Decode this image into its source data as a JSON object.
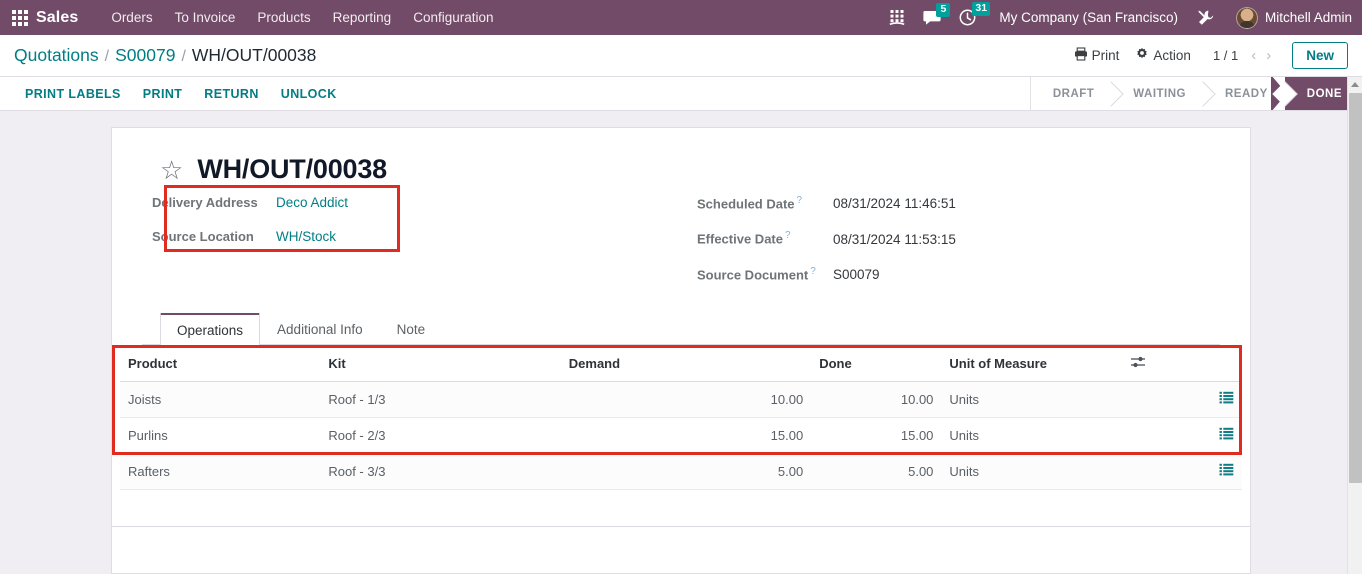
{
  "navbar": {
    "apps_icon": "apps-grid-icon",
    "brand": "Sales",
    "menus": [
      {
        "label": "Orders"
      },
      {
        "label": "To Invoice"
      },
      {
        "label": "Products"
      },
      {
        "label": "Reporting"
      },
      {
        "label": "Configuration"
      }
    ],
    "icons": {
      "dialpad": "dialpad-icon",
      "messages": "chat-icon",
      "messages_count": "5",
      "activities": "clock-icon",
      "activities_count": "31",
      "debug": "wrench-icon"
    },
    "company": "My Company (San Francisco)",
    "user": "Mitchell Admin",
    "accent_color": "#714B67",
    "badge_color": "#00A09D"
  },
  "control_panel": {
    "breadcrumb": [
      {
        "label": "Quotations",
        "current": false
      },
      {
        "label": "S00079",
        "current": false
      },
      {
        "label": "WH/OUT/00038",
        "current": true
      }
    ],
    "separator": "/",
    "print_label": "Print",
    "action_label": "Action",
    "pager": "1 / 1",
    "prev_arrow": "‹",
    "next_arrow": "›",
    "new_label": "New"
  },
  "statusbar": {
    "buttons": [
      {
        "label": "PRINT LABELS"
      },
      {
        "label": "PRINT"
      },
      {
        "label": "RETURN"
      },
      {
        "label": "UNLOCK"
      }
    ],
    "stages": [
      {
        "label": "DRAFT",
        "active": false
      },
      {
        "label": "WAITING",
        "active": false
      },
      {
        "label": "READY",
        "active": false
      },
      {
        "label": "DONE",
        "active": true
      }
    ]
  },
  "record": {
    "favorite_icon": "star-outline-icon",
    "title": "WH/OUT/00038",
    "fields_left": [
      {
        "label": "Delivery Address",
        "value": "Deco Addict",
        "link": true,
        "help": false
      },
      {
        "label": "Source Location",
        "value": "WH/Stock",
        "link": true,
        "help": false
      }
    ],
    "fields_right": [
      {
        "label": "Scheduled Date",
        "value": "08/31/2024 11:46:51",
        "link": false,
        "help": true
      },
      {
        "label": "Effective Date",
        "value": "08/31/2024 11:53:15",
        "link": false,
        "help": true
      },
      {
        "label": "Source Document",
        "value": "S00079",
        "link": false,
        "help": true
      }
    ],
    "help_marker": "?"
  },
  "tabs": [
    {
      "label": "Operations",
      "active": true
    },
    {
      "label": "Additional Info",
      "active": false
    },
    {
      "label": "Note",
      "active": false
    }
  ],
  "operations_table": {
    "columns": [
      {
        "label": "Product",
        "align": "left"
      },
      {
        "label": "Kit",
        "align": "left"
      },
      {
        "label": "Demand",
        "align": "right"
      },
      {
        "label": "Done",
        "align": "right"
      },
      {
        "label": "Unit of Measure",
        "align": "left"
      },
      {
        "label": "",
        "align": "right"
      }
    ],
    "optional_columns_icon": "sliders-icon",
    "row_detail_icon": "list-lines-icon",
    "rows": [
      {
        "product": "Joists",
        "kit": "Roof - 1/3",
        "demand": "10.00",
        "done": "10.00",
        "uom": "Units"
      },
      {
        "product": "Purlins",
        "kit": "Roof - 2/3",
        "demand": "15.00",
        "done": "15.00",
        "uom": "Units"
      },
      {
        "product": "Rafters",
        "kit": "Roof - 3/3",
        "demand": "5.00",
        "done": "5.00",
        "uom": "Units"
      }
    ]
  },
  "annotations": {
    "highlight_color": "#e02b20",
    "boxes": [
      {
        "name": "fields-highlight"
      },
      {
        "name": "table-rows-highlight"
      }
    ]
  }
}
